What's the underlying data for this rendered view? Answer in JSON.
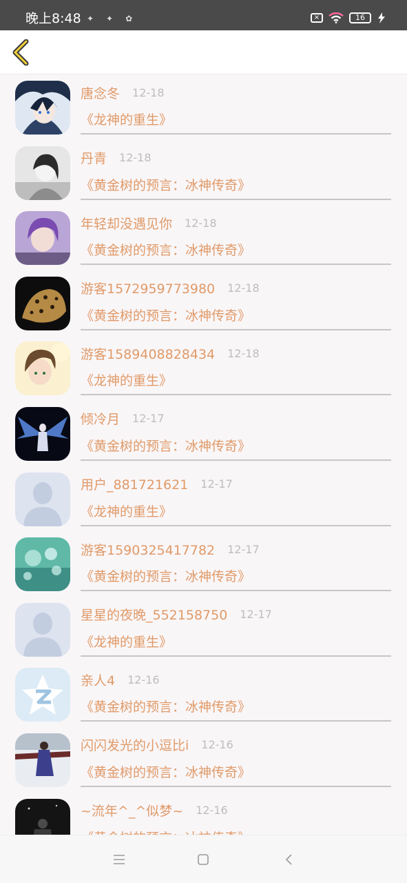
{
  "status_bar": {
    "time": "晚上8:48",
    "battery": "16"
  },
  "toolbar": {
    "back_icon": "chevron-left-icon"
  },
  "comments": [
    {
      "name": "唐念冬",
      "date": "12-18",
      "book": "《龙神的重生》",
      "avatar": "anime-blue"
    },
    {
      "name": "丹青",
      "date": "12-18",
      "book": "《黄金树的预言：冰神传奇》",
      "avatar": "gray-girl"
    },
    {
      "name": "年轻却没遇见你",
      "date": "12-18",
      "book": "《黄金树的预言：冰神传奇》",
      "avatar": "purple-boy"
    },
    {
      "name": "游客1572959773980",
      "date": "12-18",
      "book": "《黄金树的预言：冰神传奇》",
      "avatar": "leopard"
    },
    {
      "name": "游客1589408828434",
      "date": "12-18",
      "book": "《龙神的重生》",
      "avatar": "anime-sun"
    },
    {
      "name": "倾冷月",
      "date": "12-17",
      "book": "《黄金树的预言：冰神传奇》",
      "avatar": "angel"
    },
    {
      "name": "用户_881721621",
      "date": "12-17",
      "book": "《龙神的重生》",
      "avatar": "default"
    },
    {
      "name": "游客1590325417782",
      "date": "12-17",
      "book": "《黄金树的预言：冰神传奇》",
      "avatar": "bubbles"
    },
    {
      "name": "星星的夜晚_552158750",
      "date": "12-17",
      "book": "《龙神的重生》",
      "avatar": "default"
    },
    {
      "name": "亲人4",
      "date": "12-16",
      "book": "《黄金树的预言：冰神传奇》",
      "avatar": "qzone"
    },
    {
      "name": "闪闪发光的小逗比i",
      "date": "12-16",
      "book": "《黄金树的预言：冰神传奇》",
      "avatar": "snow-figure"
    },
    {
      "name": "~流年^_^似梦~",
      "date": "12-16",
      "book": "《黄金树的预言：冰神传奇》",
      "avatar": "dark-night"
    }
  ],
  "nav_bar": {
    "icons": [
      "menu-icon",
      "home-square-icon",
      "back-triangle-icon"
    ]
  },
  "colors": {
    "accent": "#e09a68",
    "date": "#bdbdbd",
    "background": "#f9f6f8"
  }
}
